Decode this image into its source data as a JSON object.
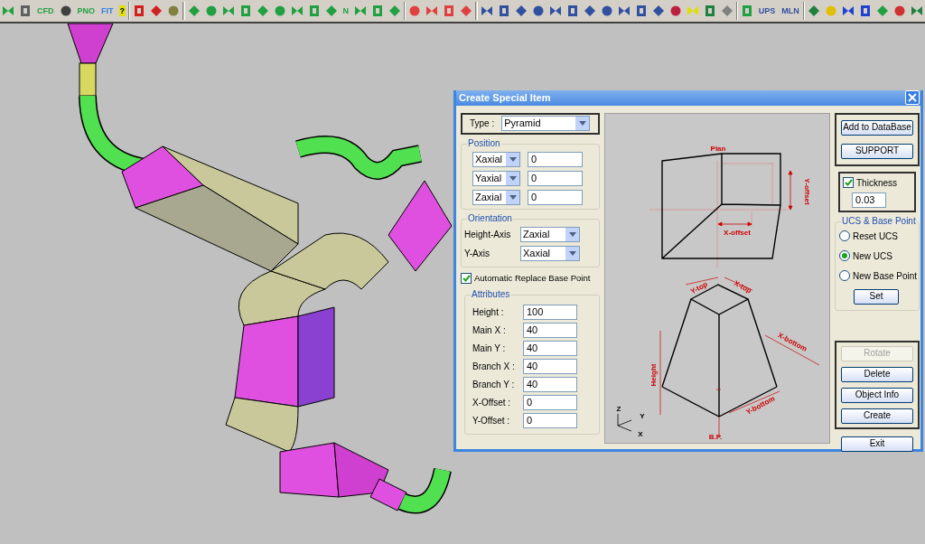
{
  "toolbar": {
    "groups": [
      [
        {
          "kind": "icon",
          "color": "#20a040"
        },
        {
          "kind": "icon",
          "color": "#606060"
        },
        {
          "kind": "text",
          "label": "CFD",
          "color": "#20a040"
        },
        {
          "kind": "icon",
          "color": "#404040"
        },
        {
          "kind": "text",
          "label": "PNO",
          "color": "#20a040"
        },
        {
          "kind": "text",
          "label": "FIT",
          "color": "#3080e0"
        },
        {
          "kind": "text",
          "label": "?",
          "color": "#e0e000"
        }
      ],
      [
        {
          "kind": "icon",
          "color": "#d02020"
        },
        {
          "kind": "icon",
          "color": "#d02020"
        },
        {
          "kind": "icon",
          "color": "#808040"
        }
      ],
      [
        {
          "kind": "icon",
          "color": "#20a040"
        },
        {
          "kind": "icon",
          "color": "#20a040"
        },
        {
          "kind": "icon",
          "color": "#20a040"
        },
        {
          "kind": "icon",
          "color": "#20a040"
        },
        {
          "kind": "icon",
          "color": "#20a040"
        },
        {
          "kind": "icon",
          "color": "#20a040"
        },
        {
          "kind": "icon",
          "color": "#20a040"
        },
        {
          "kind": "icon",
          "color": "#20a040"
        },
        {
          "kind": "icon",
          "color": "#20a040"
        },
        {
          "kind": "text",
          "label": "N",
          "color": "#20a040"
        },
        {
          "kind": "icon",
          "color": "#20a040"
        },
        {
          "kind": "icon",
          "color": "#20a040"
        },
        {
          "kind": "icon",
          "color": "#20a040"
        }
      ],
      [
        {
          "kind": "icon",
          "color": "#e04040"
        },
        {
          "kind": "icon",
          "color": "#e04040"
        },
        {
          "kind": "icon",
          "color": "#e04040"
        },
        {
          "kind": "icon",
          "color": "#e04040"
        }
      ],
      [
        {
          "kind": "icon",
          "color": "#3050a0"
        },
        {
          "kind": "icon",
          "color": "#3050a0"
        },
        {
          "kind": "icon",
          "color": "#3050a0"
        },
        {
          "kind": "icon",
          "color": "#3050a0"
        },
        {
          "kind": "icon",
          "color": "#3050a0"
        },
        {
          "kind": "icon",
          "color": "#3050a0"
        },
        {
          "kind": "icon",
          "color": "#3050a0"
        },
        {
          "kind": "icon",
          "color": "#3050a0"
        },
        {
          "kind": "icon",
          "color": "#3050a0"
        },
        {
          "kind": "icon",
          "color": "#3050a0"
        },
        {
          "kind": "icon",
          "color": "#3050a0"
        },
        {
          "kind": "icon",
          "color": "#c02040"
        },
        {
          "kind": "icon",
          "color": "#e0e000"
        },
        {
          "kind": "icon",
          "color": "#208040"
        },
        {
          "kind": "icon",
          "color": "#808080"
        }
      ],
      [
        {
          "kind": "icon",
          "color": "#20a040"
        },
        {
          "kind": "text",
          "label": "UPS",
          "color": "#3050a0"
        },
        {
          "kind": "text",
          "label": "MLN",
          "color": "#3050a0"
        }
      ],
      [
        {
          "kind": "icon",
          "color": "#208040"
        },
        {
          "kind": "icon",
          "color": "#e0c000"
        },
        {
          "kind": "icon",
          "color": "#2040d0"
        },
        {
          "kind": "icon",
          "color": "#2040d0"
        },
        {
          "kind": "icon",
          "color": "#20a040"
        },
        {
          "kind": "icon",
          "color": "#d03030"
        },
        {
          "kind": "icon",
          "color": "#208040"
        }
      ]
    ]
  },
  "dialog": {
    "title": "Create Special Item",
    "type": {
      "label": "Type :",
      "value": "Pyramid"
    },
    "position": {
      "title": "Position",
      "rows": [
        {
          "axis": "Xaxial",
          "value": "0"
        },
        {
          "axis": "Yaxial",
          "value": "0"
        },
        {
          "axis": "Zaxial",
          "value": "0"
        }
      ]
    },
    "orientation": {
      "title": "Orientation",
      "rows": [
        {
          "label": "Height-Axis",
          "value": "Zaxial"
        },
        {
          "label": "Y-Axis",
          "value": "Xaxial"
        }
      ]
    },
    "auto_replace": {
      "label": "Automatic Replace Base Point",
      "checked": true
    },
    "attributes": {
      "title": "Attributes",
      "rows": [
        {
          "label": "Height :",
          "value": "100"
        },
        {
          "label": "Main X :",
          "value": "40"
        },
        {
          "label": "Main Y :",
          "value": "40"
        },
        {
          "label": "Branch X :",
          "value": "40"
        },
        {
          "label": "Branch Y :",
          "value": "40"
        },
        {
          "label": "X-Offset :",
          "value": "0"
        },
        {
          "label": "Y-Offset :",
          "value": "0"
        }
      ]
    },
    "diagram": {
      "labels": [
        "Plan",
        "Y-offset",
        "X-offset",
        "Y-top",
        "X-top",
        "X-bottom",
        "Height",
        "Y-bottom",
        "B.P.",
        "Z",
        "Y",
        "X"
      ]
    },
    "top_buttons": [
      "Add to DataBase",
      "SUPPORT"
    ],
    "thickness": {
      "label": "Thickness",
      "checked": true,
      "value": "0.03"
    },
    "ucs": {
      "title": "UCS & Base Point",
      "options": [
        {
          "label": "Reset UCS",
          "selected": false
        },
        {
          "label": "New UCS",
          "selected": true
        },
        {
          "label": "New Base Point",
          "selected": false
        }
      ],
      "button": "Set"
    },
    "actions": [
      {
        "label": "Rotate",
        "disabled": true
      },
      {
        "label": "Delete",
        "disabled": false
      },
      {
        "label": "Object Info",
        "disabled": false
      },
      {
        "label": "Create",
        "disabled": false
      }
    ],
    "exit": "Exit"
  }
}
